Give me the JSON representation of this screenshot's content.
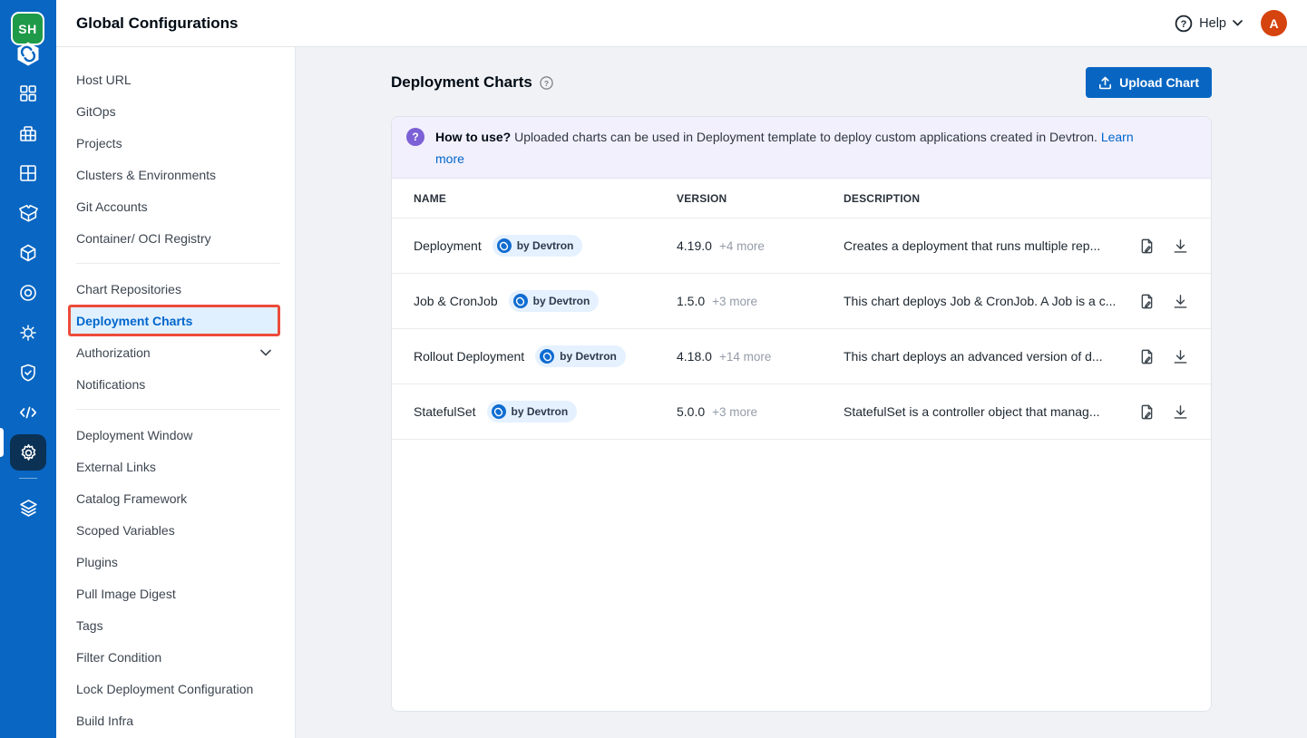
{
  "colors": {
    "rail_blue": "#0966c2",
    "accent_blue": "#0066cc",
    "selected_outline_red": "#ec4c3b",
    "banner_bg": "#f2f0fd",
    "banner_icon_purple": "#7c60d6",
    "avatar_orange": "#d5430e",
    "logo_green": "#1e9a49",
    "badge_bg": "#e5f1ff"
  },
  "rail": {
    "logo_text": "SH",
    "icons": [
      "devtron-logo",
      "applications",
      "jobs",
      "application-groups",
      "chart-store",
      "resource-browser",
      "bullseye",
      "cluster",
      "security",
      "code",
      "global-configurations",
      "stack"
    ]
  },
  "header": {
    "title": "Global Configurations",
    "help_label": "Help",
    "avatar_initial": "A"
  },
  "sidebar": {
    "groups": [
      [
        {
          "label": "Host URL"
        },
        {
          "label": "GitOps"
        },
        {
          "label": "Projects"
        },
        {
          "label": "Clusters & Environments"
        },
        {
          "label": "Git Accounts"
        },
        {
          "label": "Container/ OCI Registry"
        }
      ],
      [
        {
          "label": "Chart Repositories"
        },
        {
          "label": "Deployment Charts",
          "selected": true
        },
        {
          "label": "Authorization",
          "chevron": true
        },
        {
          "label": "Notifications"
        }
      ],
      [
        {
          "label": "Deployment Window"
        },
        {
          "label": "External Links"
        },
        {
          "label": "Catalog Framework"
        },
        {
          "label": "Scoped Variables"
        },
        {
          "label": "Plugins"
        },
        {
          "label": "Pull Image Digest"
        },
        {
          "label": "Tags"
        },
        {
          "label": "Filter Condition"
        },
        {
          "label": "Lock Deployment Configuration"
        },
        {
          "label": "Build Infra"
        }
      ]
    ]
  },
  "page": {
    "title": "Deployment Charts",
    "upload_button": "Upload Chart",
    "banner": {
      "bold": "How to use?",
      "text": "Uploaded charts can be used in Deployment template to deploy custom applications created in Devtron.",
      "link": "Learn more"
    }
  },
  "table": {
    "headers": [
      "NAME",
      "VERSION",
      "DESCRIPTION"
    ],
    "rows": [
      {
        "name": "Deployment",
        "badge": "by Devtron",
        "version": "4.19.0",
        "more": "+4 more",
        "description": "Creates a deployment that runs multiple rep..."
      },
      {
        "name": "Job & CronJob",
        "badge": "by Devtron",
        "version": "1.5.0",
        "more": "+3 more",
        "description": "This chart deploys Job & CronJob. A Job is a c..."
      },
      {
        "name": "Rollout Deployment",
        "badge": "by Devtron",
        "version": "4.18.0",
        "more": "+14 more",
        "description": "This chart deploys an advanced version of d..."
      },
      {
        "name": "StatefulSet",
        "badge": "by Devtron",
        "version": "5.0.0",
        "more": "+3 more",
        "description": "StatefulSet is a controller object that manag..."
      }
    ]
  }
}
